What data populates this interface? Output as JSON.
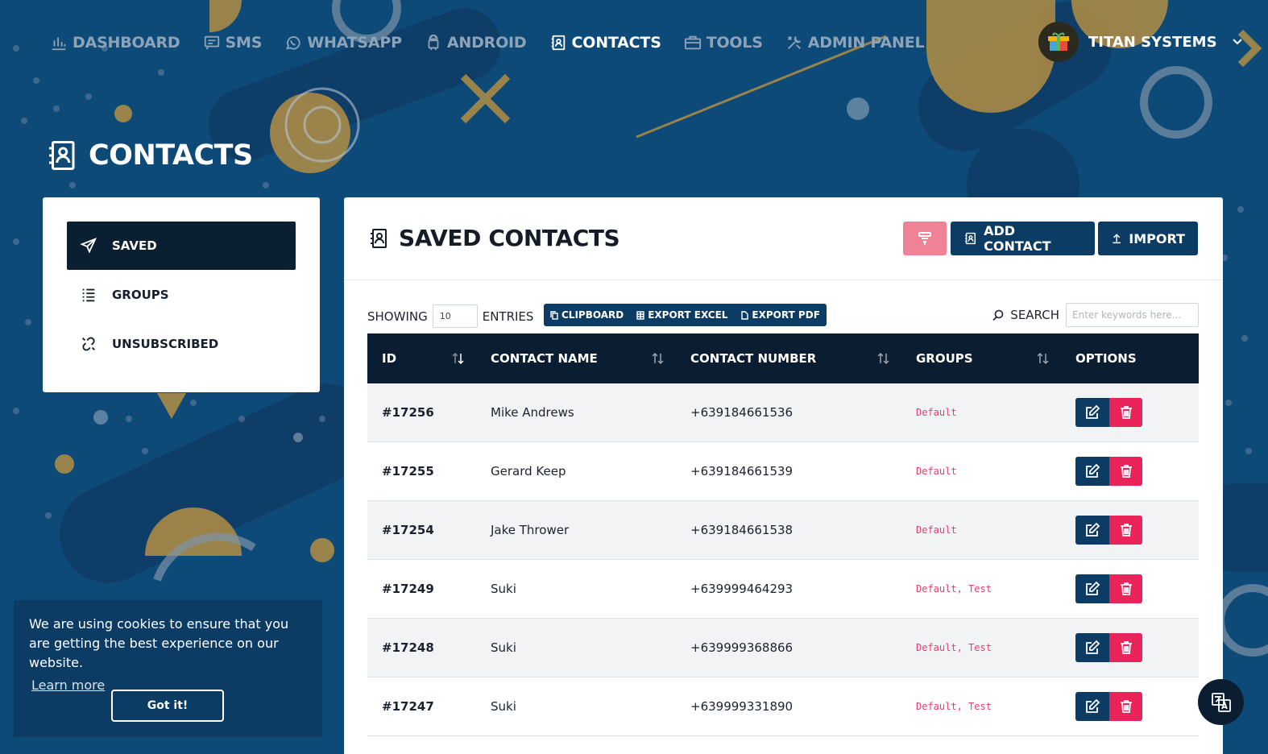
{
  "nav": {
    "items": [
      {
        "label": "DASHBOARD",
        "icon": "bar-chart-icon"
      },
      {
        "label": "SMS",
        "icon": "message-icon"
      },
      {
        "label": "WHATSAPP",
        "icon": "whatsapp-icon"
      },
      {
        "label": "ANDROID",
        "icon": "android-icon"
      },
      {
        "label": "CONTACTS",
        "icon": "contacts-icon",
        "active": true
      },
      {
        "label": "TOOLS",
        "icon": "toolbox-icon"
      },
      {
        "label": "ADMIN PANEL",
        "icon": "tools-icon"
      }
    ],
    "account_name": "TITAN SYSTEMS"
  },
  "page_title": "CONTACTS",
  "sidebar": {
    "items": [
      {
        "label": "SAVED",
        "icon": "send-icon",
        "active": true
      },
      {
        "label": "GROUPS",
        "icon": "list-icon"
      },
      {
        "label": "UNSUBSCRIBED",
        "icon": "unlink-icon"
      }
    ]
  },
  "card": {
    "title": "SAVED CONTACTS",
    "add_label": "ADD CONTACT",
    "import_label": "IMPORT"
  },
  "table_controls": {
    "showing_label": "SHOWING",
    "entries_value": "10",
    "entries_label": "ENTRIES",
    "export_buttons": [
      "CLIPBOARD",
      "EXPORT EXCEL",
      "EXPORT PDF"
    ],
    "search_label": "SEARCH",
    "search_placeholder": "Enter keywords here..."
  },
  "table": {
    "headers": [
      "ID",
      "CONTACT NAME",
      "CONTACT NUMBER",
      "GROUPS",
      "OPTIONS"
    ],
    "rows": [
      {
        "id": "#17256",
        "name": "Mike Andrews",
        "number": "+639184661536",
        "groups": "Default"
      },
      {
        "id": "#17255",
        "name": "Gerard Keep",
        "number": "+639184661539",
        "groups": "Default"
      },
      {
        "id": "#17254",
        "name": "Jake Thrower",
        "number": "+639184661538",
        "groups": "Default"
      },
      {
        "id": "#17249",
        "name": "Suki",
        "number": "+639999464293",
        "groups": "Default, Test"
      },
      {
        "id": "#17248",
        "name": "Suki",
        "number": "+639999368866",
        "groups": "Default, Test"
      },
      {
        "id": "#17247",
        "name": "Suki",
        "number": "+639999331890",
        "groups": "Default, Test"
      }
    ]
  },
  "cookie": {
    "message": "We are using cookies to ensure that you are getting the best experience on our website.",
    "learn_more": "Learn more",
    "accept": "Got it!"
  },
  "colors": {
    "background": "#0d4a78",
    "navy": "#0c3c64",
    "dark": "#0b1d30",
    "danger": "#e8245a",
    "accent_pink": "#f08296",
    "gold": "#b38e44"
  }
}
